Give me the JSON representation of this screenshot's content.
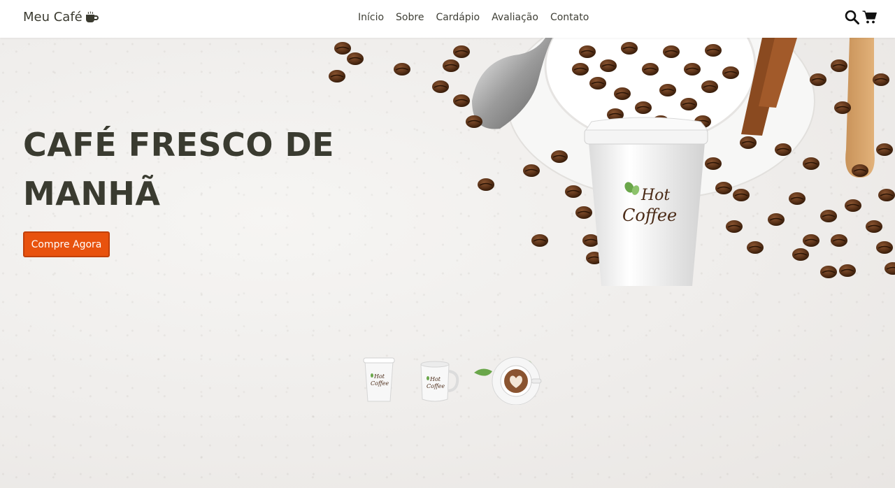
{
  "header": {
    "brand": "Meu Café",
    "brand_icon": "coffee-mug-icon",
    "nav": [
      "Início",
      "Sobre",
      "Cardápio",
      "Avaliação",
      "Contato"
    ],
    "icons": [
      "search-icon",
      "cart-icon"
    ]
  },
  "hero": {
    "title": "CAFÉ FRESCO DE MANHÃ",
    "cta_label": "Compre Agora",
    "cup_logo_text_1": "Hot",
    "cup_logo_text_2": "Coffee"
  },
  "thumbnails": [
    {
      "name": "paper-cup-thumb",
      "text_1": "Hot",
      "text_2": "Coffee"
    },
    {
      "name": "mug-thumb",
      "text_1": "Hot",
      "text_2": "Coffee"
    },
    {
      "name": "latte-thumb"
    }
  ],
  "colors": {
    "accent": "#e8520e",
    "title": "#3a3b30",
    "header_bg": "#ffffff",
    "green_leaf": "#6aa64a",
    "bean_brown": "#4a2a16"
  }
}
